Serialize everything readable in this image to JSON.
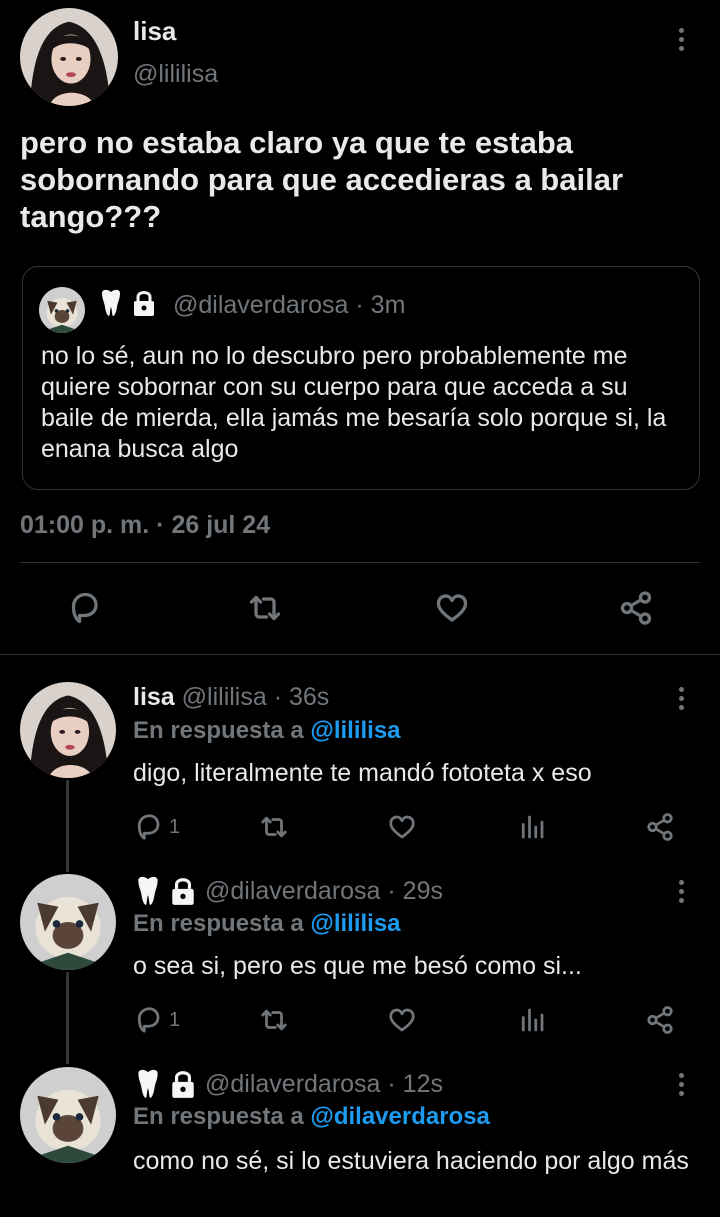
{
  "main_tweet": {
    "name": "lisa",
    "handle": "@lililisa",
    "text": "pero no estaba claro ya que te estaba sobornando para que accedieras a bailar tango???",
    "quote": {
      "handle_time": "@dilaverdarosa · 3m",
      "emojis": [
        "tooth-emoji",
        "lock-emoji"
      ],
      "text": "no lo sé, aun no lo descubro pero probablemente me quiere sobornar con su cuerpo para que acceda a su baile de mierda, ella jamás me besaría solo porque si, la enana busca algo"
    },
    "timestamp": "01:00 p. m. · 26 jul 24",
    "actions": [
      "reply-icon",
      "retweet-icon",
      "like-icon",
      "share-icon"
    ]
  },
  "replies": [
    {
      "name": "lisa",
      "handle_time": "@lililisa · 36s",
      "reply_prefix": "En respuesta a",
      "reply_to": "@lililisa",
      "text": "digo, literalmente te mandó fototeta x eso",
      "reply_count": "1"
    },
    {
      "name": "",
      "emojis": [
        "tooth-emoji",
        "lock-emoji"
      ],
      "handle_time": "@dilaverdarosa · 29s",
      "reply_prefix": "En respuesta a",
      "reply_to": "@lililisa",
      "text": "o sea si, pero es que me besó como si...",
      "reply_count": "1"
    },
    {
      "name": "",
      "emojis": [
        "tooth-emoji",
        "lock-emoji"
      ],
      "handle_time": "@dilaverdarosa · 12s",
      "reply_prefix": "En respuesta a",
      "reply_to": "@dilaverdarosa",
      "text": "como no sé, si lo estuviera haciendo por algo más"
    }
  ],
  "colors": {
    "background": "#000000",
    "text": "#e7e9ea",
    "muted": "#71767b",
    "link": "#1d9bf0",
    "border": "#2f3336"
  }
}
